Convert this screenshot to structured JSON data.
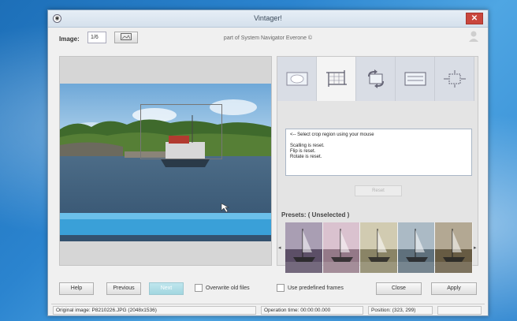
{
  "window": {
    "title": "Vintager!",
    "close_glyph": "✕",
    "app_icon": "◉"
  },
  "toolbar": {
    "image_label": "Image:",
    "image_value": "1/6",
    "open_icon": "folder-image-icon",
    "subtitle": "part of System Navigator Everone ©",
    "user_icon": "person-icon"
  },
  "tools": [
    {
      "name": "vignette-tool",
      "icon": "vignette-icon",
      "active": false
    },
    {
      "name": "crop-tool",
      "icon": "crop-icon",
      "active": true
    },
    {
      "name": "flip-rotate-tool",
      "icon": "flip-rotate-icon",
      "active": false
    },
    {
      "name": "frames-tool",
      "icon": "frame-icon",
      "active": false
    },
    {
      "name": "adjust-tool",
      "icon": "adjust-icon",
      "active": false
    }
  ],
  "info": {
    "lines": [
      "<-- Select crop region using your mouse",
      "",
      "Scalling is reset.",
      "Flip is reset.",
      "Rotate is reset."
    ]
  },
  "reset_label": "Reset",
  "presets": {
    "label": "Presets: ( Unselected )",
    "tints": [
      "#7b6a8a",
      "#c6a2b6",
      "#b8b088",
      "#7f96a6",
      "#8a7a5a"
    ]
  },
  "buttons": {
    "help": "Help",
    "previous": "Previous",
    "next": "Next",
    "overwrite_label": "Overwrite old files",
    "predefined_label": "Use predefined frames",
    "close": "Close",
    "apply": "Apply"
  },
  "status": {
    "original_image": "Original image: P8210226.JPG (2048x1536)",
    "operation_time": "Operation time: 00:00:00.000",
    "position": "Position: (323, 299)"
  },
  "colors": {
    "accent_close": "#c9463d",
    "next_button": "#a2d6e0",
    "desktop": "#2b84cf"
  }
}
